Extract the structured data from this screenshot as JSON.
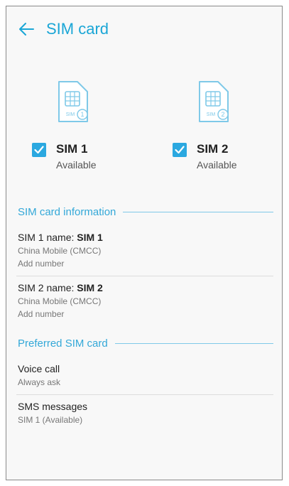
{
  "header": {
    "title": "SIM card",
    "back_icon": "arrow-left-icon"
  },
  "sims": [
    {
      "label": "SIM 1",
      "status": "Available",
      "badge": "SIM",
      "number": "1",
      "checked": true
    },
    {
      "label": "SIM 2",
      "status": "Available",
      "badge": "SIM",
      "number": "2",
      "checked": true
    }
  ],
  "sim_info": {
    "title": "SIM card information",
    "items": [
      {
        "name_prefix": "SIM 1 name: ",
        "name_value": "SIM 1",
        "carrier": "China Mobile (CMCC)",
        "action": "Add number"
      },
      {
        "name_prefix": "SIM 2 name: ",
        "name_value": "SIM 2",
        "carrier": "China Mobile (CMCC)",
        "action": "Add number"
      }
    ]
  },
  "preferred": {
    "title": "Preferred SIM card",
    "items": [
      {
        "title": "Voice call",
        "subtitle": "Always ask"
      },
      {
        "title": "SMS messages",
        "subtitle": "SIM 1 (Available)"
      }
    ]
  },
  "colors": {
    "accent": "#1aa6d6",
    "checkbox": "#2ba8e0",
    "icon_outline": "#7fc9e8"
  }
}
